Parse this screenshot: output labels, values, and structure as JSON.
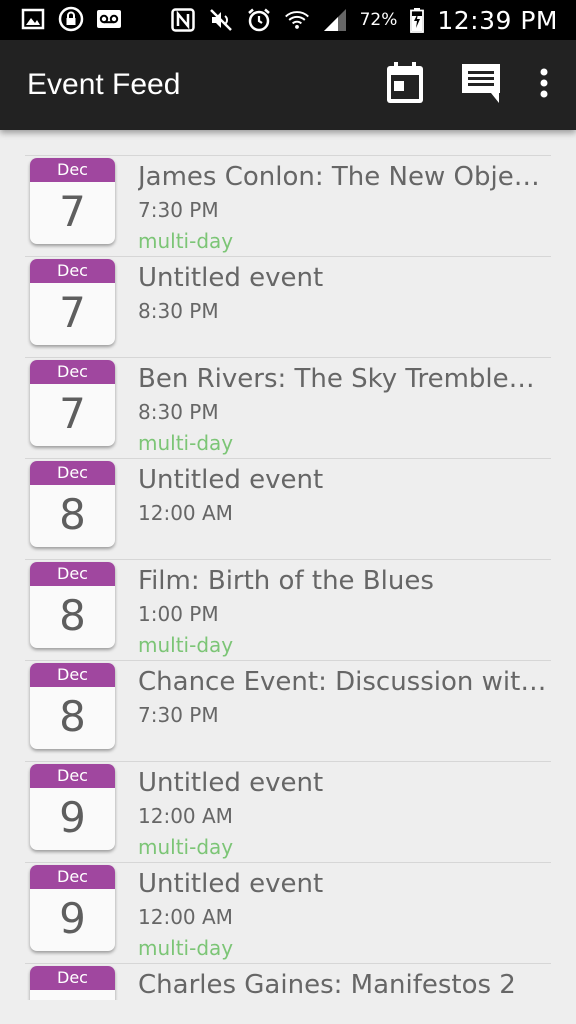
{
  "status_bar": {
    "icons_left": [
      "image-icon",
      "lock-icon",
      "voicemail-icon"
    ],
    "icons_right": [
      "nfc-icon",
      "mute-icon",
      "alarm-icon",
      "wifi-icon",
      "signal-icon"
    ],
    "battery": "72%",
    "time": "12:39 PM"
  },
  "app_bar": {
    "title": "Event Feed",
    "actions": [
      "calendar-icon",
      "message-icon",
      "overflow-menu-icon"
    ]
  },
  "colors": {
    "calendar_header": "#a0479f",
    "multi_day_tag": "#7cc576",
    "app_bar": "#222222"
  },
  "events": [
    {
      "month": "Dec",
      "day": "7",
      "title": "James Conlon: The New Objec…",
      "time": "7:30 PM",
      "tag": "multi-day"
    },
    {
      "month": "Dec",
      "day": "7",
      "title": "Untitled event",
      "time": "8:30 PM",
      "tag": ""
    },
    {
      "month": "Dec",
      "day": "7",
      "title": "Ben Rivers: The Sky Trembles…",
      "time": "8:30 PM",
      "tag": "multi-day"
    },
    {
      "month": "Dec",
      "day": "8",
      "title": "Untitled event",
      "time": "12:00 AM",
      "tag": ""
    },
    {
      "month": "Dec",
      "day": "8",
      "title": "Film: Birth of the Blues",
      "time": "1:00 PM",
      "tag": "multi-day"
    },
    {
      "month": "Dec",
      "day": "8",
      "title": "Chance Event: Discussion wit…",
      "time": "7:30 PM",
      "tag": ""
    },
    {
      "month": "Dec",
      "day": "9",
      "title": "Untitled event",
      "time": "12:00 AM",
      "tag": "multi-day"
    },
    {
      "month": "Dec",
      "day": "9",
      "title": "Untitled event",
      "time": "12:00 AM",
      "tag": "multi-day"
    },
    {
      "month": "Dec",
      "day": "",
      "title": "Charles Gaines: Manifestos 2",
      "time": "",
      "tag": ""
    }
  ]
}
